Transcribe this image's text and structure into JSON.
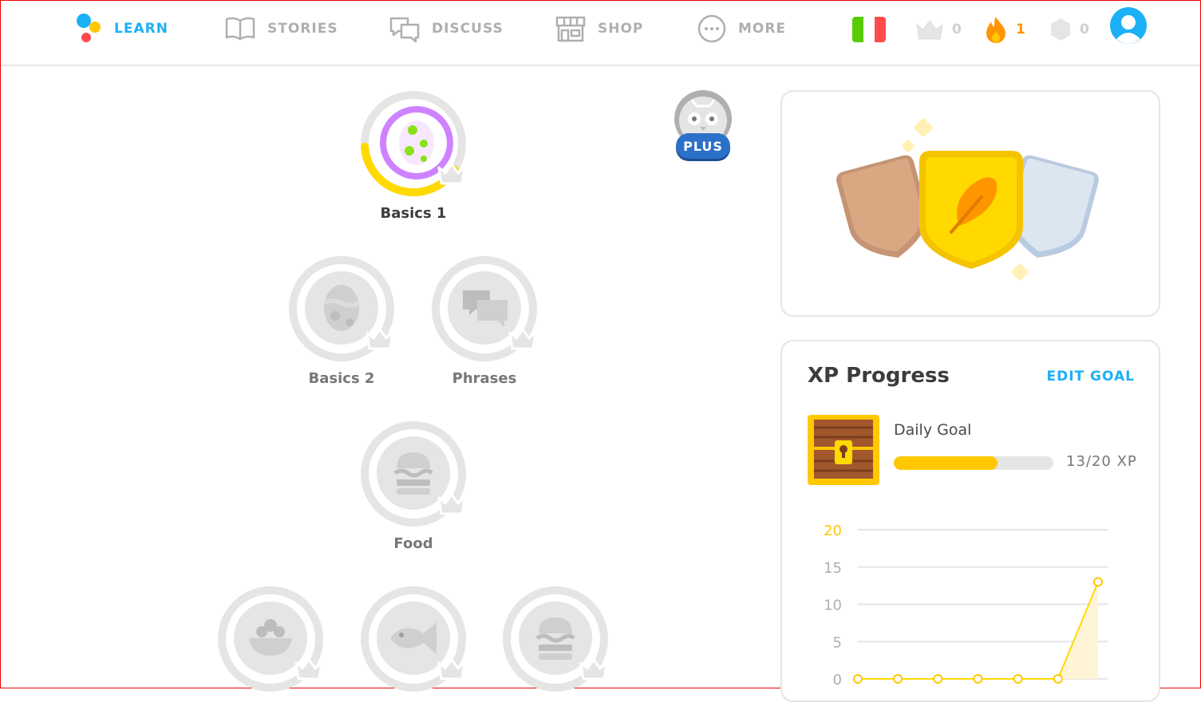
{
  "nav": {
    "learn": "LEARN",
    "stories": "STORIES",
    "discuss": "DISCUSS",
    "shop": "SHOP",
    "more": "MORE"
  },
  "stats": {
    "crowns": "0",
    "streak": "1",
    "gems": "0"
  },
  "colors": {
    "accent": "#1cb0f6",
    "gold": "#ffc800",
    "purple": "#ce82ff",
    "streak": "#ff9600"
  },
  "plus_badge": "PLUS",
  "skills": {
    "basics1": {
      "label": "Basics 1",
      "progress": 0.4
    },
    "basics2": {
      "label": "Basics 2"
    },
    "phrases": {
      "label": "Phrases"
    },
    "food": {
      "label": "Food"
    }
  },
  "xp": {
    "title": "XP Progress",
    "edit_goal": "EDIT GOAL",
    "daily_goal_label": "Daily Goal",
    "current": 13,
    "goal": 20,
    "progress_text": "13/20 XP"
  },
  "chart_data": {
    "type": "line",
    "x": [
      1,
      2,
      3,
      4,
      5,
      6,
      7
    ],
    "values": [
      0,
      0,
      0,
      0,
      0,
      0,
      13
    ],
    "yticks": [
      "0",
      "5",
      "10",
      "15",
      "20"
    ],
    "ylim": [
      0,
      20
    ],
    "xlabel": "",
    "ylabel": "",
    "grid": true
  }
}
